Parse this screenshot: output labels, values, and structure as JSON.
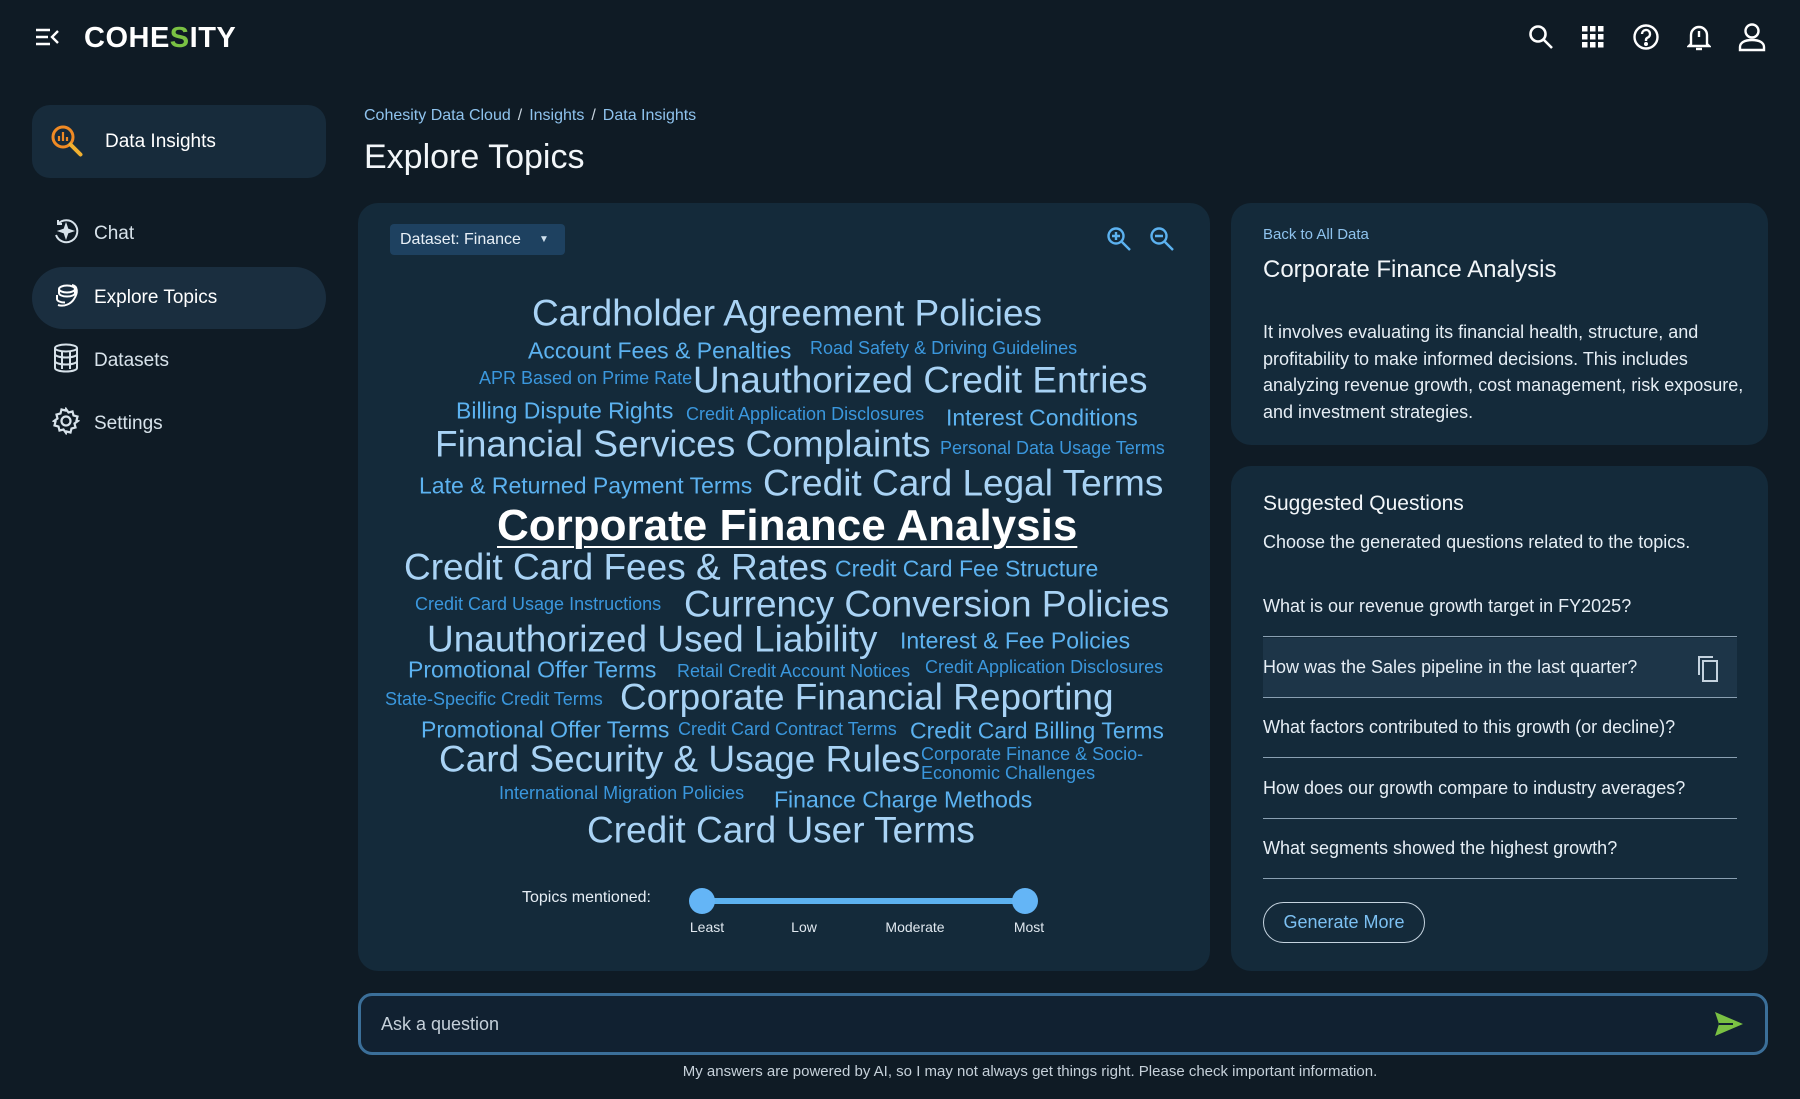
{
  "header": {
    "logo_pre": "COHE",
    "logo_s": "S",
    "logo_post": "ITY",
    "icons": [
      "menu-collapse-icon",
      "search-icon",
      "apps-grid-icon",
      "help-icon",
      "bell-icon",
      "user-icon"
    ]
  },
  "sidebar": {
    "app_title": "Data Insights",
    "items": [
      {
        "label": "Chat",
        "icon": "chat-sparkle-icon"
      },
      {
        "label": "Explore Topics",
        "icon": "topics-icon",
        "active": true
      },
      {
        "label": "Datasets",
        "icon": "database-icon"
      },
      {
        "label": "Settings",
        "icon": "gear-icon"
      }
    ]
  },
  "breadcrumb": [
    "Cohesity Data Cloud",
    "Insights",
    "Data Insights"
  ],
  "page_title": "Explore Topics",
  "explore": {
    "dataset_label": "Dataset: Finance",
    "words": [
      {
        "text": "Cardholder Agreement Policies",
        "tier": "xl"
      },
      {
        "text": "Account Fees & Penalties",
        "tier": "l"
      },
      {
        "text": "Road Safety & Driving Guidelines",
        "tier": "s"
      },
      {
        "text": "APR Based on Prime Rate",
        "tier": "s"
      },
      {
        "text": "Unauthorized Credit Entries",
        "tier": "xl"
      },
      {
        "text": "Billing Dispute Rights",
        "tier": "l"
      },
      {
        "text": "Credit Application Disclosures",
        "tier": "s"
      },
      {
        "text": "Interest Conditions",
        "tier": "l"
      },
      {
        "text": "Financial Services Complaints",
        "tier": "xl"
      },
      {
        "text": "Personal Data Usage Terms",
        "tier": "s"
      },
      {
        "text": "Late & Returned Payment Terms",
        "tier": "l"
      },
      {
        "text": "Credit Card Legal Terms",
        "tier": "xl"
      },
      {
        "text": "Corporate Finance Analysis",
        "tier": "selected"
      },
      {
        "text": "Credit Card Fees & Rates",
        "tier": "xl"
      },
      {
        "text": "Credit Card Fee Structure",
        "tier": "l"
      },
      {
        "text": "Credit Card Usage Instructions",
        "tier": "s"
      },
      {
        "text": "Currency Conversion Policies",
        "tier": "xl"
      },
      {
        "text": "Unauthorized Used Liability",
        "tier": "xl"
      },
      {
        "text": "Interest & Fee Policies",
        "tier": "l"
      },
      {
        "text": "Promotional Offer Terms",
        "tier": "l"
      },
      {
        "text": "Retail Credit Account Notices",
        "tier": "s"
      },
      {
        "text": "Credit Application Disclosures",
        "tier": "s"
      },
      {
        "text": "State-Specific Credit Terms",
        "tier": "s"
      },
      {
        "text": "Corporate Financial Reporting",
        "tier": "xl"
      },
      {
        "text": "Promotional Offer Terms",
        "tier": "l"
      },
      {
        "text": "Credit Card Contract Terms",
        "tier": "s"
      },
      {
        "text": "Credit Card Billing Terms",
        "tier": "l"
      },
      {
        "text": "Card Security & Usage Rules",
        "tier": "xl"
      },
      {
        "text": "Corporate Finance & Socio-Economic Challenges",
        "tier": "s"
      },
      {
        "text": "International Migration Policies",
        "tier": "s"
      },
      {
        "text": "Finance Charge Methods",
        "tier": "l"
      },
      {
        "text": "Credit Card User Terms",
        "tier": "xl"
      }
    ],
    "slider": {
      "label": "Topics mentioned:",
      "ticks": [
        "Least",
        "Low",
        "Moderate",
        "Most"
      ],
      "range": [
        "Least",
        "Most"
      ]
    }
  },
  "detail": {
    "back": "Back to All Data",
    "title": "Corporate Finance Analysis",
    "description": "It involves evaluating its financial health, structure, and profitability to make informed decisions. This includes analyzing revenue growth, cost management, risk exposure, and investment strategies."
  },
  "questions": {
    "title": "Suggested Questions",
    "subtitle": "Choose the generated questions related to the topics.",
    "items": [
      "What is our revenue growth target in FY2025?",
      "How was the Sales pipeline in the last quarter?",
      "What factors contributed to this growth (or decline)?",
      "How does our growth compare to industry averages?",
      "What segments showed the highest growth?"
    ],
    "generate": "Generate More"
  },
  "ask": {
    "placeholder": "Ask a question"
  },
  "disclaimer": "My answers are powered by AI, so I may not always get things right. Please check important information.",
  "colors": {
    "background": "#0f1b25",
    "card": "#142a3a",
    "accent": "#5cb2f0",
    "brand_green": "#7ac143",
    "send": "#7ac143"
  }
}
